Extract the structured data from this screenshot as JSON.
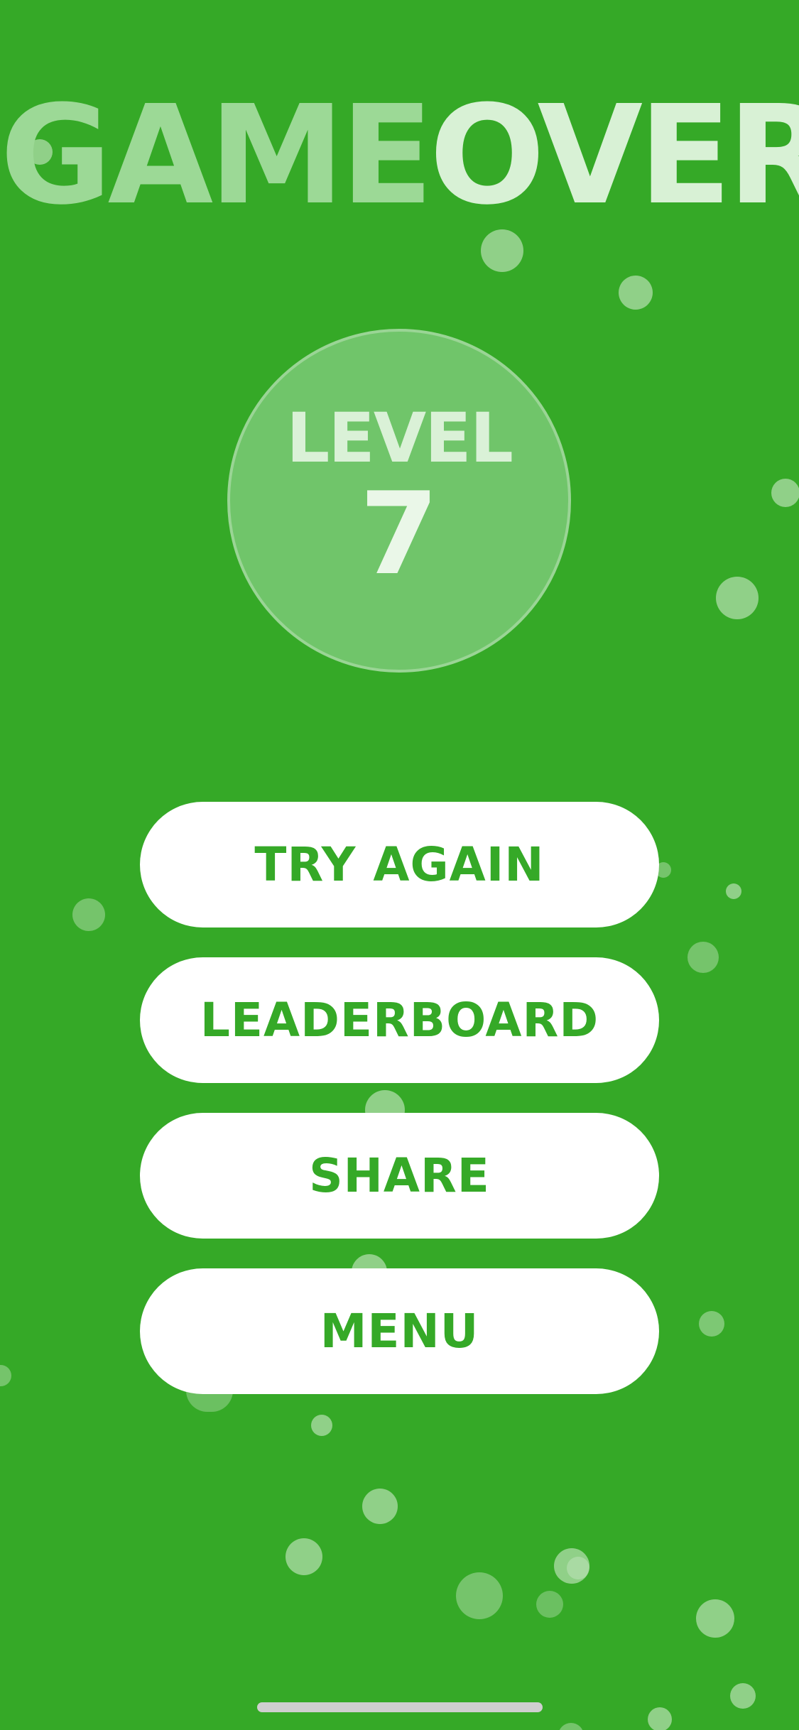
{
  "title": {
    "word1": "GAME",
    "word2": "OVER"
  },
  "level": {
    "label": "LEVEL",
    "number": "7"
  },
  "buttons": {
    "try_again": "TRY AGAIN",
    "leaderboard": "LEADERBOARD",
    "share": "SHARE",
    "menu": "MENU"
  },
  "colors": {
    "background": "#35a927",
    "button_bg": "#ffffff",
    "button_text": "#35a927",
    "title_game": "#9cd996",
    "title_over": "#d8f1d5",
    "level_circle": "#70c56a"
  }
}
